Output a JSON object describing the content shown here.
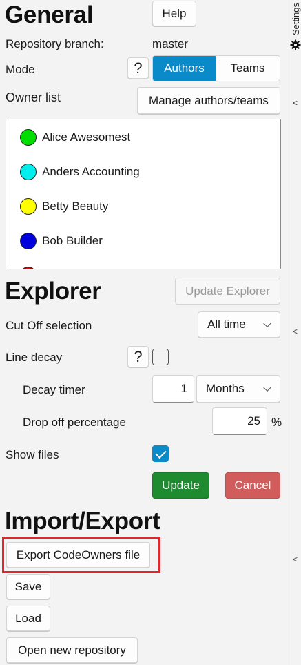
{
  "general": {
    "title": "General",
    "help_label": "Help",
    "branch_label": "Repository branch:",
    "branch_value": "master",
    "mode_label": "Mode",
    "mode_help": "?",
    "mode_options": [
      "Authors",
      "Teams"
    ],
    "mode_selected": "Authors",
    "owner_list_label": "Owner list",
    "manage_button": "Manage authors/teams",
    "owners": [
      {
        "name": "Alice Awesomest",
        "color": "#00dd00"
      },
      {
        "name": "Anders Accounting",
        "color": "#00eeee"
      },
      {
        "name": "Betty Beauty",
        "color": "#ffff00"
      },
      {
        "name": "Bob Builder",
        "color": "#0000dd"
      },
      {
        "name": "",
        "color": "#dd0000"
      }
    ]
  },
  "explorer": {
    "title": "Explorer",
    "update_explorer_button": "Update Explorer",
    "cutoff_label": "Cut Off selection",
    "cutoff_value": "All time",
    "line_decay_label": "Line decay",
    "line_decay_help": "?",
    "line_decay_checked": false,
    "decay_timer_label": "Decay timer",
    "decay_timer_value": "1",
    "decay_timer_unit": "Months",
    "dropoff_label": "Drop off percentage",
    "dropoff_value": "25",
    "dropoff_unit": "%",
    "show_files_label": "Show files",
    "show_files_checked": true,
    "update_button": "Update",
    "cancel_button": "Cancel"
  },
  "import_export": {
    "title": "Import/Export",
    "export_button": "Export CodeOwners file",
    "save_button": "Save",
    "load_button": "Load",
    "open_repo_button": "Open new repository"
  },
  "sidebar": {
    "label": "Settings",
    "collapse_glyph": "<"
  },
  "colors": {
    "accent": "#0a8ac9",
    "update_green": "#1f8b30",
    "cancel_red": "#d05c5c",
    "highlight_red": "#e3262b"
  }
}
